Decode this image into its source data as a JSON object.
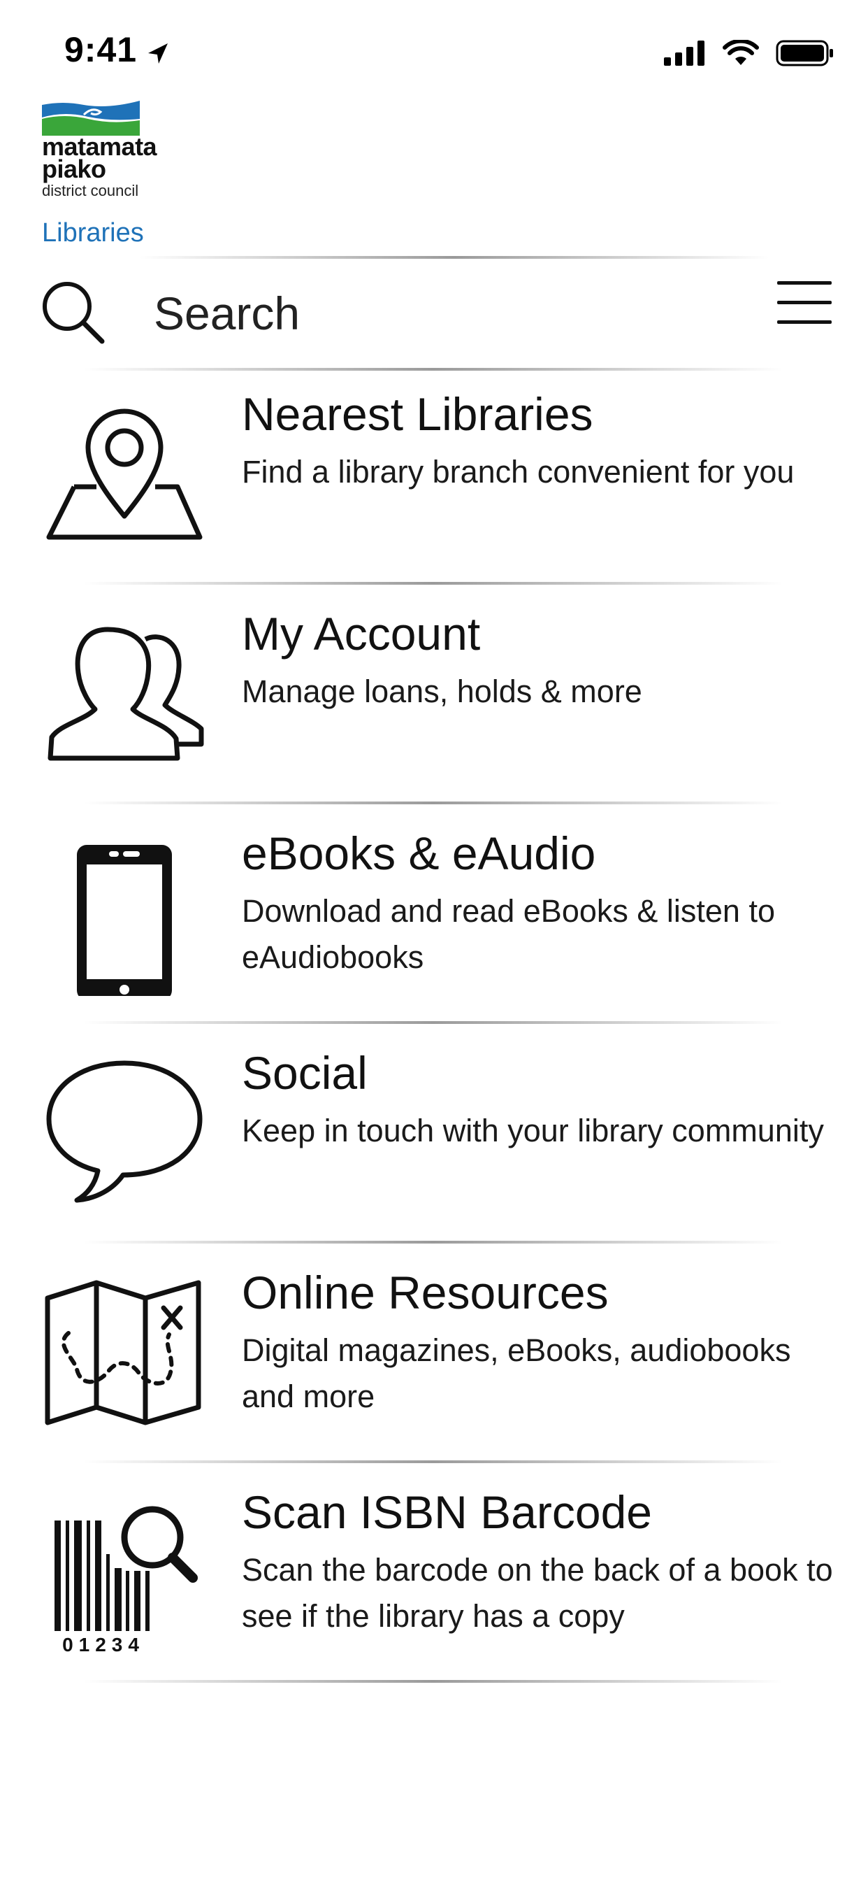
{
  "status_bar": {
    "time": "9:41"
  },
  "logo": {
    "line1": "matamata",
    "line2": "piako",
    "line3": "district council",
    "section": "Libraries"
  },
  "search": {
    "placeholder": "Search"
  },
  "menu": [
    {
      "title": "Nearest Libraries",
      "description": "Find a library branch convenient for you",
      "icon": "map-pin-icon"
    },
    {
      "title": "My Account",
      "description": "Manage loans, holds & more",
      "icon": "users-icon"
    },
    {
      "title": "eBooks & eAudio",
      "description": "Download and read eBooks & listen to eAudiobooks",
      "icon": "phone-icon"
    },
    {
      "title": "Social",
      "description": "Keep in touch with your library community",
      "icon": "speech-bubble-icon"
    },
    {
      "title": "Online Resources",
      "description": "Digital magazines, eBooks, audiobooks and more",
      "icon": "treasure-map-icon"
    },
    {
      "title": "Scan ISBN Barcode",
      "description": "Scan the barcode on the back of a book to see if the library has a copy",
      "icon": "barcode-search-icon",
      "barcode_digits": "01234"
    }
  ],
  "colors": {
    "brand_blue": "#1f72b8",
    "brand_green": "#3aa63a",
    "text": "#111111"
  }
}
